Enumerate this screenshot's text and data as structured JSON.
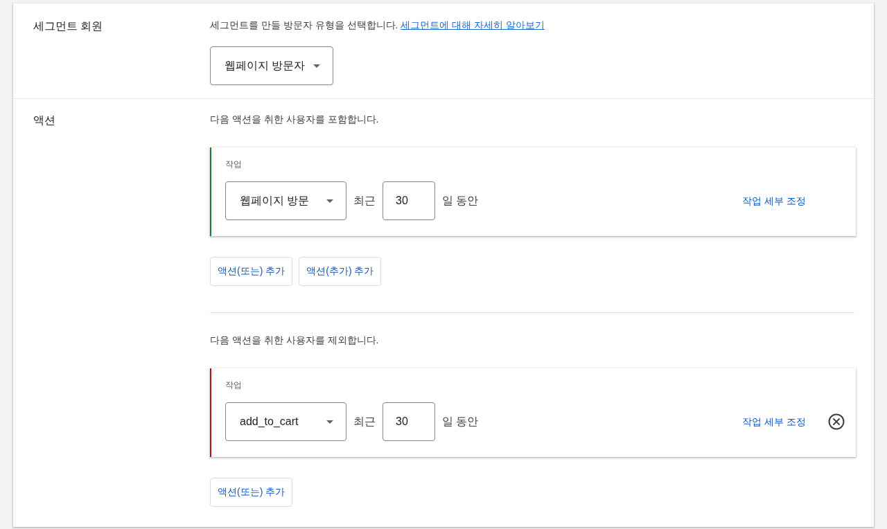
{
  "sections": [
    {
      "kind": "membership",
      "title": "세그먼트 회원",
      "description": "세그먼트를 만들 방문자 유형을 선택합니다.",
      "link": "세그먼트에 대해 자세히 알아보기",
      "dropdown": "웹페이지 방문자"
    },
    {
      "kind": "actions",
      "title": "액션",
      "groups": [
        {
          "description": "다음 액션을 취한 사용자를 포함합니다.",
          "color": "#188038",
          "conditions": [
            {
              "label": "작업",
              "action": "웹페이지 방문",
              "prefix": "최근",
              "days": "30",
              "suffix": "일 동안",
              "link": "작업 세부 조정",
              "removable": false
            }
          ],
          "buttons": [
            "액션(또는) 추가",
            "액션(추가) 추가"
          ]
        },
        {
          "description": "다음 액션을 취한 사용자를 제외합니다.",
          "color": "#b31412",
          "conditions": [
            {
              "label": "작업",
              "action": "add_to_cart",
              "prefix": "최근",
              "days": "30",
              "suffix": "일 동안",
              "link": "작업 세부 조정",
              "removable": true
            }
          ],
          "buttons": [
            "액션(또는) 추가"
          ]
        }
      ]
    }
  ]
}
